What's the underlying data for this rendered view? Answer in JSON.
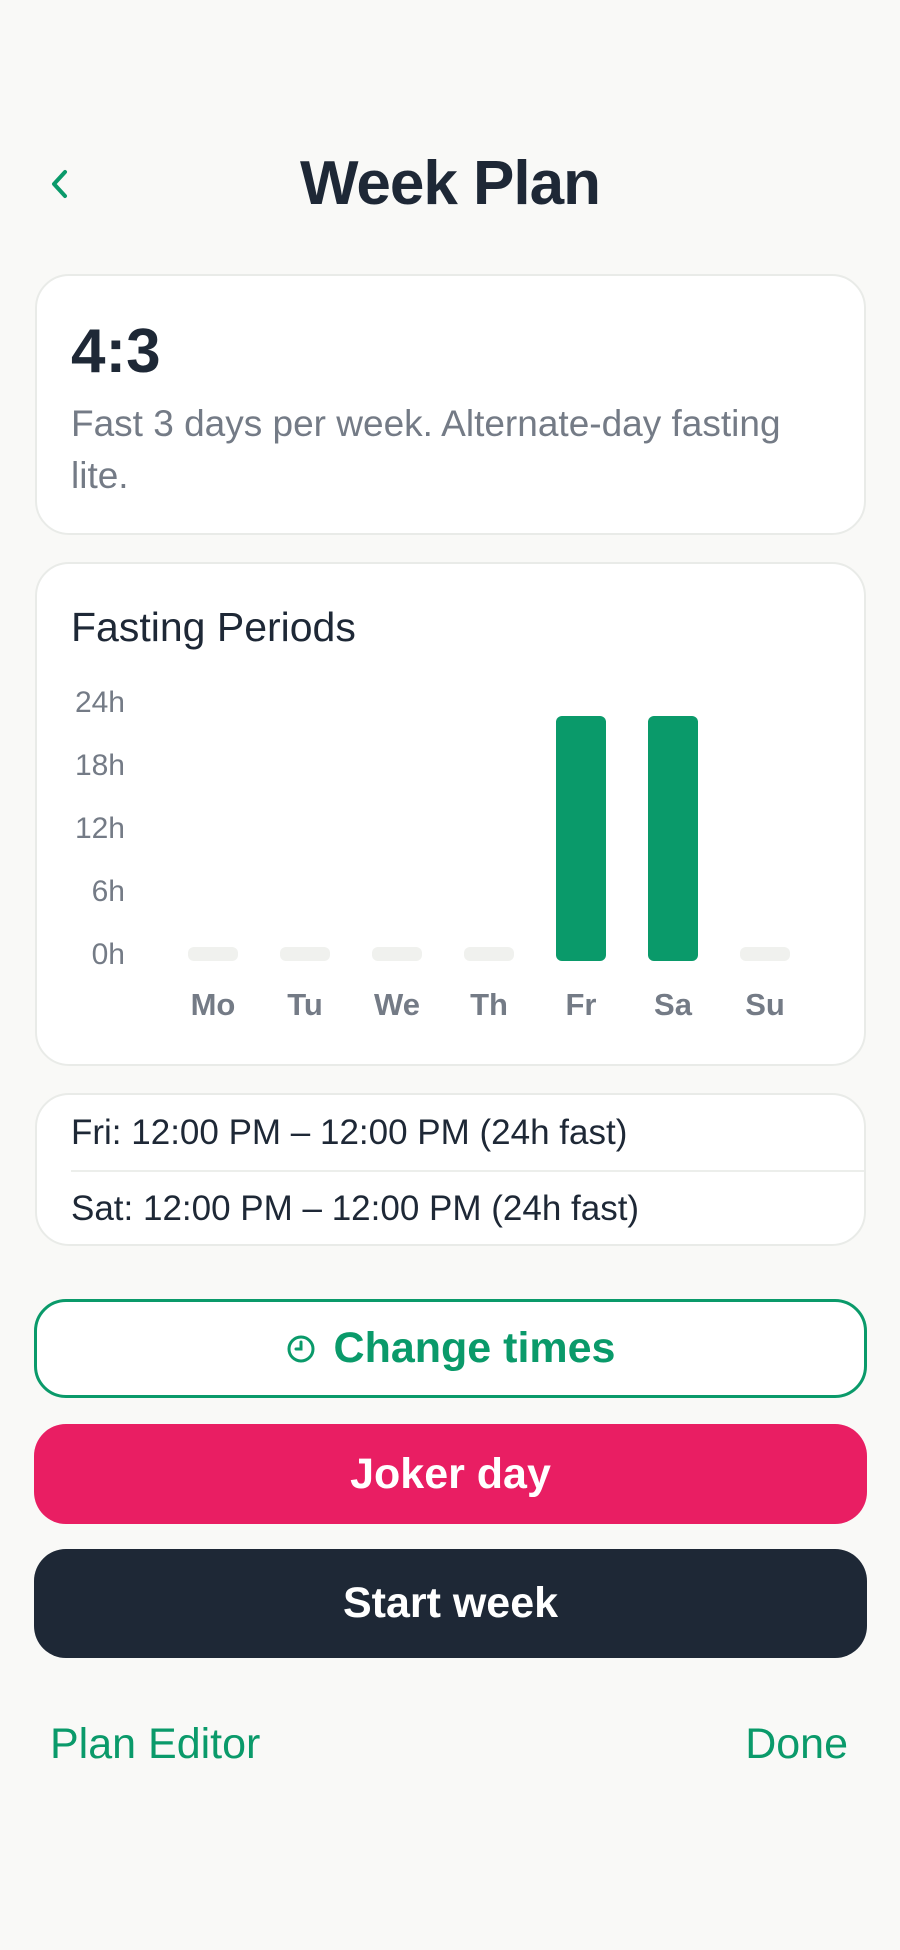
{
  "header": {
    "title": "Week Plan",
    "back_icon": "chevron-left-icon"
  },
  "plan": {
    "ratio": "4:3",
    "description": "Fast 3 days per week. Alternate-day fasting lite."
  },
  "chart_data": {
    "type": "bar",
    "title": "Fasting Periods",
    "categories": [
      "Mo",
      "Tu",
      "We",
      "Th",
      "Fr",
      "Sa",
      "Su"
    ],
    "values": [
      0,
      0,
      0,
      0,
      24,
      24,
      0
    ],
    "y_ticks": [
      "24h",
      "18h",
      "12h",
      "6h",
      "0h"
    ],
    "ylim": [
      0,
      24
    ],
    "bar_color": "#0a9a6a",
    "empty_bar_color": "#f0f1ee"
  },
  "periods": [
    "Fri: 12:00 PM – 12:00 PM (24h fast)",
    "Sat: 12:00 PM – 12:00 PM (24h fast)"
  ],
  "buttons": {
    "change_times": "Change times",
    "change_times_icon": "clock-icon",
    "joker_day": "Joker day",
    "start_week": "Start week"
  },
  "footer": {
    "plan_editor": "Plan Editor",
    "done": "Done"
  },
  "colors": {
    "accent": "#0a9a6a",
    "joker": "#e91e63",
    "dark": "#1e2836"
  }
}
